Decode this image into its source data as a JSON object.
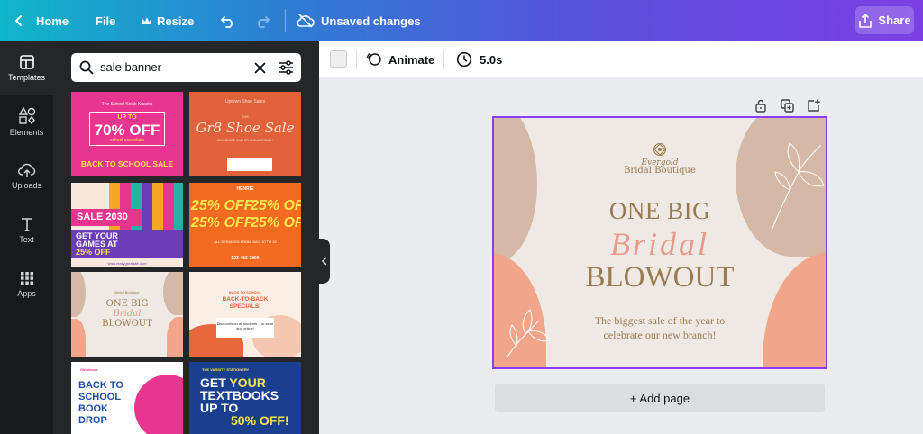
{
  "topbar": {
    "home_label": "Home",
    "file_label": "File",
    "resize_label": "Resize",
    "status": "Unsaved changes",
    "share_label": "Share"
  },
  "rail": {
    "items": [
      {
        "label": "Templates"
      },
      {
        "label": "Elements"
      },
      {
        "label": "Uploads"
      },
      {
        "label": "Text"
      },
      {
        "label": "Apps"
      }
    ]
  },
  "search": {
    "value": "sale banner"
  },
  "templates": {
    "t1": {
      "brand": "The School Knick Knacks",
      "line1": "UP TO",
      "big": "70% OFF",
      "line2": "school essentials",
      "footer": "BACK TO SCHOOL SALE"
    },
    "t2": {
      "brand": "Uptown Shoe Sales",
      "mid": "THE",
      "title": "Gr8 Shoe Sale",
      "sub": "CELEBRATE OUR 8TH ANNIVERSARY"
    },
    "t3": {
      "sale": "SALE 2030",
      "headline1": "GET YOUR",
      "headline2": "GAMES AT",
      "headline3": "25% OFF",
      "url": "www.reallygreatsite.com"
    },
    "t4": {
      "brand": "HENRIE",
      "row": "25% OFF",
      "sub": "ALL SERVICES FROM JULY 10 TO 18",
      "phone": "123-456-7890"
    },
    "t5": {
      "brand": "Bridal Boutique",
      "l1": "ONE BIG",
      "l2": "Bridal",
      "l3": "BLOWOUT"
    },
    "t6": {
      "l1": "BACK TO SCHOOL",
      "l2": "BACK-TO-BACK",
      "l3": "SPECIALS!",
      "l4": "Discounts on all students -- in-store and online!"
    },
    "t7": {
      "brand": "Oklahoma",
      "l1": "BACK TO",
      "l2": "SCHOOL",
      "l3": "BOOK",
      "l4": "DROP"
    },
    "t8": {
      "brand": "THE VARSITY STATIONERY",
      "l1": "GET",
      "l2": "YOUR",
      "l3": "TEXTBOOKS",
      "l4": "UP TO",
      "l5": "50% OFF!"
    }
  },
  "toolbar": {
    "animate_label": "Animate",
    "duration": "5.0s"
  },
  "design": {
    "brand_script": "Evergold",
    "brand_name": "Bridal Boutique",
    "line1": "ONE BIG",
    "line2": "Bridal",
    "line3": "BLOWOUT",
    "sub1": "The biggest sale of the year to",
    "sub2": "celebrate our new branch!"
  },
  "add_page_label": "+ Add page",
  "colors": {
    "accent": "#8b3dff",
    "peach": "#f1a58a",
    "taupe": "#d5b9a6",
    "gold": "#9a7b4f",
    "pink_script": "#eb9a8a"
  }
}
